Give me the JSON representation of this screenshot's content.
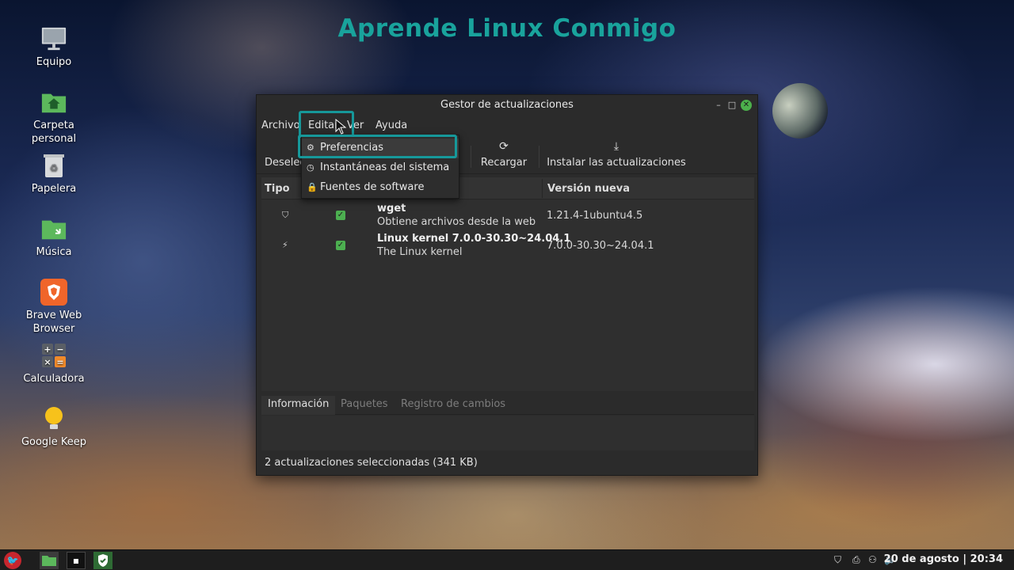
{
  "desktop": {
    "watermark": "Aprende Linux Conmigo",
    "icons": [
      {
        "label": "Equipo",
        "icon": "monitor-icon"
      },
      {
        "label": "Carpeta personal",
        "icon": "home-folder-icon"
      },
      {
        "label": "Papelera",
        "icon": "trash-icon"
      },
      {
        "label": "Música",
        "icon": "music-folder-icon"
      },
      {
        "label": "Brave Web Browser",
        "icon": "brave-icon"
      },
      {
        "label": "Calculadora",
        "icon": "calculator-icon"
      },
      {
        "label": "Google Keep",
        "icon": "lightbulb-icon"
      }
    ]
  },
  "window": {
    "title": "Gestor de actualizaciones",
    "menu": {
      "archivo": "Archivo",
      "editar": "Editar",
      "ver": "Ver",
      "ayuda": "Ayuda"
    },
    "toolbar": {
      "deselect": "Deseleccionar todo",
      "reload": "Recargar",
      "install": "Instalar las actualizaciones"
    },
    "table": {
      "headers": {
        "type": "Tipo",
        "version": "Versión nueva"
      },
      "rows": [
        {
          "type_icon": "shield-icon",
          "checked": true,
          "name": "wget",
          "desc": "Obtiene archivos desde la web",
          "version": "1.21.4-1ubuntu4.5"
        },
        {
          "type_icon": "lightning-icon",
          "checked": true,
          "name": "Linux kernel 7.0.0-30.30~24.04.1",
          "desc": "The Linux kernel",
          "version": "7.0.0-30.30~24.04.1"
        }
      ]
    },
    "tabs": [
      "Información",
      "Paquetes",
      "Registro de cambios"
    ],
    "status": "2 actualizaciones seleccionadas (341 KB)"
  },
  "dropdown": {
    "items": [
      {
        "label": "Preferencias",
        "icon": "preferences-icon"
      },
      {
        "label": "Instantáneas del sistema",
        "icon": "clock-icon"
      },
      {
        "label": "Fuentes de software",
        "icon": "lock-icon"
      }
    ]
  },
  "taskbar": {
    "clock": "20 de agosto | 20:34"
  },
  "colors": {
    "accent_teal": "#16989a",
    "watermark": "#19a39c",
    "check_green": "#4caf50"
  }
}
